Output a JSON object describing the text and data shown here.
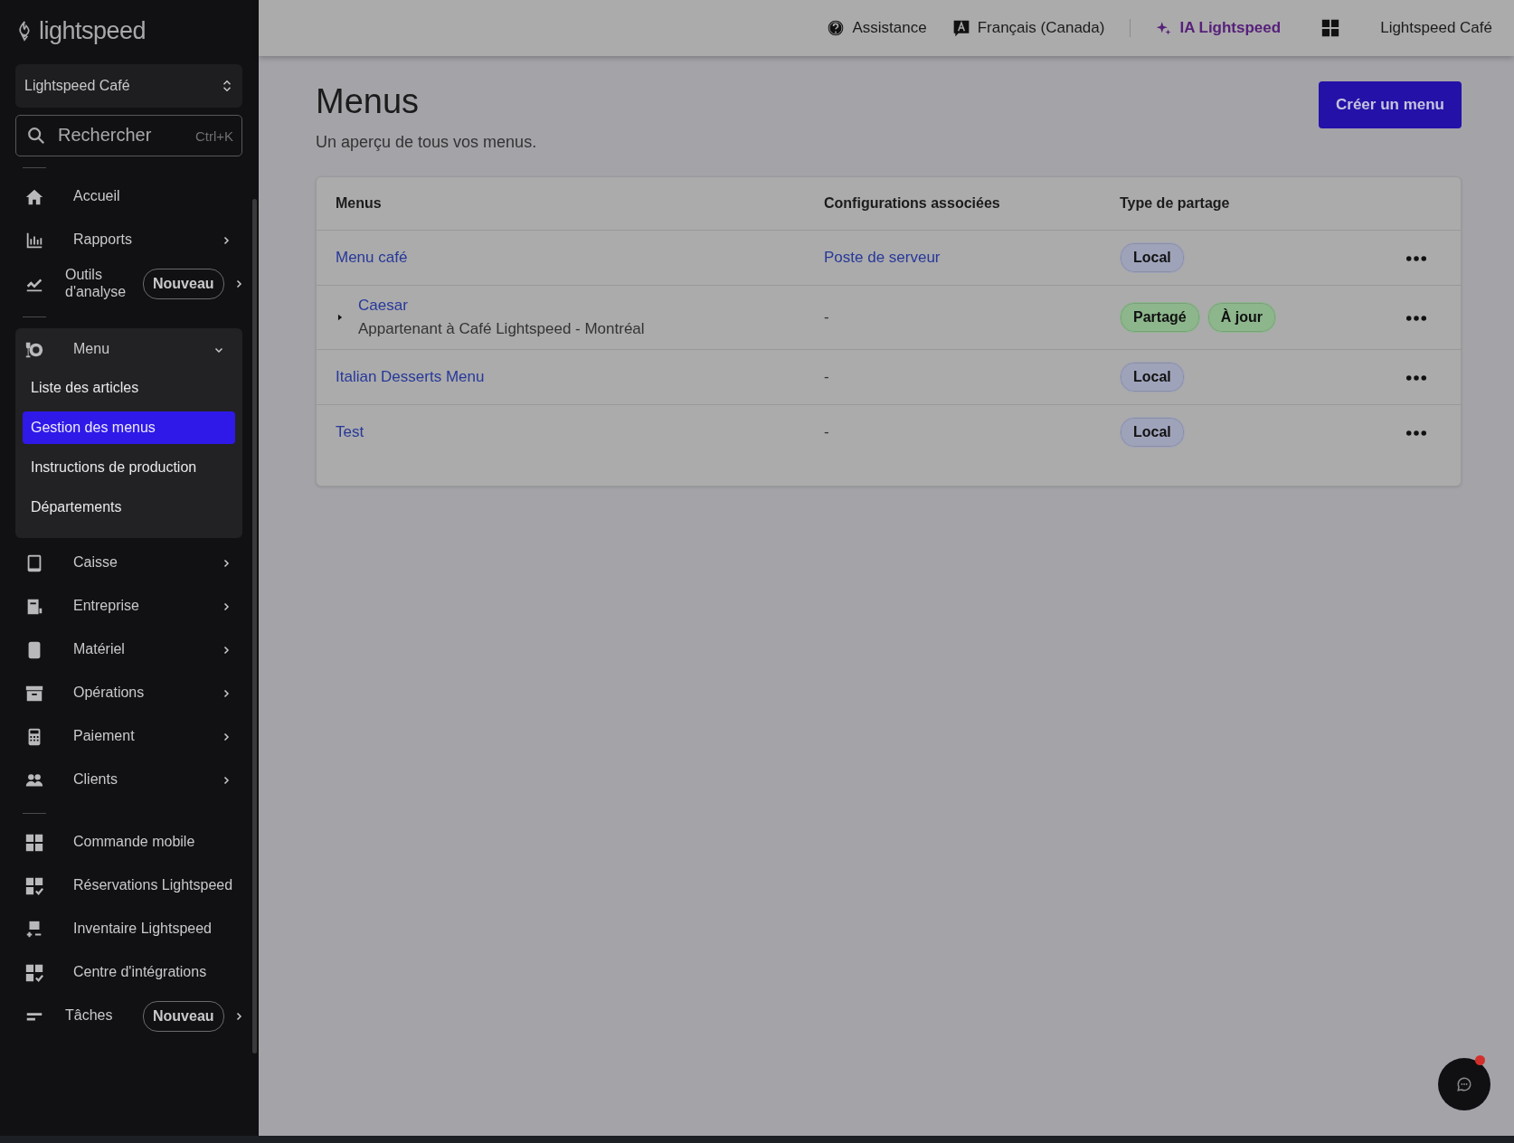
{
  "sidebar": {
    "logo": "lightspeed",
    "location": "Lightspeed Café",
    "search": {
      "placeholder": "Rechercher",
      "shortcut": "Ctrl+K"
    },
    "sections": [
      {
        "items": [
          {
            "label": "Accueil",
            "chevron": false
          },
          {
            "label": "Rapports",
            "chevron": true
          },
          {
            "label": "Outils d'analyse",
            "chevron": true,
            "badge": "Nouveau"
          }
        ]
      },
      {
        "items": [
          {
            "label": "Menu",
            "chevron": true,
            "expanded": true,
            "children": [
              {
                "label": "Liste des articles",
                "selected": false
              },
              {
                "label": "Gestion des menus",
                "selected": true
              },
              {
                "label": "Instructions de production",
                "selected": false
              },
              {
                "label": "Départements",
                "selected": false
              }
            ]
          },
          {
            "label": "Caisse",
            "chevron": true
          },
          {
            "label": "Entreprise",
            "chevron": true
          },
          {
            "label": "Matériel",
            "chevron": true
          },
          {
            "label": "Opérations",
            "chevron": true
          },
          {
            "label": "Paiement",
            "chevron": true
          },
          {
            "label": "Clients",
            "chevron": true
          }
        ]
      },
      {
        "items": [
          {
            "label": "Commande mobile",
            "chevron": false
          },
          {
            "label": "Réservations Lightspeed",
            "chevron": false
          },
          {
            "label": "Inventaire Lightspeed",
            "chevron": false
          },
          {
            "label": "Centre d'intégrations",
            "chevron": false
          },
          {
            "label": "Tâches",
            "chevron": true,
            "badge": "Nouveau"
          }
        ]
      }
    ]
  },
  "topbar": {
    "help": "Assistance",
    "language": "Français (Canada)",
    "ai": "IA Lightspeed",
    "account": "Lightspeed Café"
  },
  "page": {
    "title": "Menus",
    "subtitle": "Un aperçu de tous vos menus.",
    "create_button": "Créer un menu"
  },
  "table": {
    "columns": [
      "Menus",
      "Configurations associées",
      "Type de partage"
    ],
    "rows": [
      {
        "name": "Menu café",
        "expandable": false,
        "config": "Poste de serveur",
        "config_is_link": true,
        "tags": [
          {
            "label": "Local",
            "color": "#9fa3ba"
          }
        ]
      },
      {
        "name": "Caesar",
        "owner": "Appartenant à Café Lightspeed - Montréal",
        "expandable": true,
        "expanded": false,
        "config": "-",
        "config_is_link": false,
        "tags": [
          {
            "label": "Partagé",
            "color": "#8db68c"
          },
          {
            "label": "À jour",
            "color": "#8db68c"
          }
        ]
      },
      {
        "name": "Italian Desserts Menu",
        "expandable": false,
        "config": "-",
        "config_is_link": false,
        "tags": [
          {
            "label": "Local",
            "color": "#9fa3ba"
          }
        ]
      },
      {
        "name": "Test",
        "expandable": false,
        "config": "-",
        "config_is_link": false,
        "tags": [
          {
            "label": "Local",
            "color": "#9fa3ba"
          }
        ]
      }
    ]
  },
  "chat": {
    "unread": true
  }
}
